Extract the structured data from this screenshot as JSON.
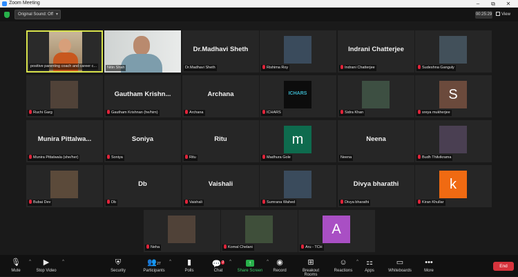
{
  "window": {
    "title": "Zoom Meeting",
    "minimize": "–",
    "maximize": "⧉",
    "close": "✕"
  },
  "topbar": {
    "sound_button": "Original Sound: Off",
    "timer": "00:25:29",
    "view_button": "View"
  },
  "tiles": [
    {
      "label": "positive parenting coach and career c...",
      "muted": false,
      "kind": "video",
      "active": true
    },
    {
      "label": "Nitin Shah",
      "muted": false,
      "kind": "video"
    },
    {
      "big_name": "Dr.Madhavi Sheth",
      "label": "Dr.Madhavi Sheth",
      "muted": false,
      "kind": "name"
    },
    {
      "label": "Rishima Roy",
      "muted": true,
      "kind": "picture"
    },
    {
      "big_name": "Indrani Chatterjee",
      "label": "Indrani Chatterjee",
      "muted": true,
      "kind": "name"
    },
    {
      "label": "Sudeshna Ganguly",
      "muted": true,
      "kind": "picture"
    },
    {
      "label": "Ruchi Garg",
      "muted": true,
      "kind": "picture"
    },
    {
      "big_name": "Gautham Krishn...",
      "label": "Gautham Krishnan (he/him)",
      "muted": true,
      "kind": "name"
    },
    {
      "big_name": "Archana",
      "label": "Archana",
      "muted": true,
      "kind": "name"
    },
    {
      "label": "ICHARS",
      "muted": true,
      "kind": "picture",
      "logo_text": "ICHARS"
    },
    {
      "label": "Sidra Khan",
      "muted": true,
      "kind": "picture"
    },
    {
      "label": "sreya mukherjee",
      "muted": true,
      "kind": "avatar",
      "avatar_letter": "S",
      "avatar_color": "#6b4a3c"
    },
    {
      "big_name": "Munira Pittalwa...",
      "label": "Munira Pittalwala (she/her)",
      "muted": true,
      "kind": "name"
    },
    {
      "big_name": "Soniya",
      "label": "Soniya",
      "muted": true,
      "kind": "name"
    },
    {
      "big_name": "Ritu",
      "label": "Ritu",
      "muted": true,
      "kind": "name"
    },
    {
      "label": "Madhura Gole",
      "muted": true,
      "kind": "avatar",
      "avatar_letter": "m",
      "avatar_color": "#0e6b4e"
    },
    {
      "big_name": "Neena",
      "label": "Neena",
      "muted": false,
      "kind": "name"
    },
    {
      "label": "Budh Thilvikrama",
      "muted": true,
      "kind": "picture"
    },
    {
      "label": "Bubai Dev",
      "muted": true,
      "kind": "picture"
    },
    {
      "big_name": "Db",
      "label": "Db",
      "muted": true,
      "kind": "name"
    },
    {
      "big_name": "Vaishali",
      "label": "Vaishali",
      "muted": true,
      "kind": "name"
    },
    {
      "label": "Sumrana Wahed",
      "muted": true,
      "kind": "picture"
    },
    {
      "big_name": "Divya bharathi",
      "label": "Divya bharathi",
      "muted": true,
      "kind": "name"
    },
    {
      "label": "Kiran Khullar",
      "muted": true,
      "kind": "avatar",
      "avatar_letter": "k",
      "avatar_color": "#f06a12"
    },
    {
      "label": "Neha",
      "muted": true,
      "kind": "picture"
    },
    {
      "label": "Komal Chelani",
      "muted": true,
      "kind": "picture"
    },
    {
      "label": "Aru - TCH",
      "muted": true,
      "kind": "avatar",
      "avatar_letter": "A",
      "avatar_color": "#a94fc4"
    }
  ],
  "toolbar": {
    "mute": "Mute",
    "stop_video": "Stop Video",
    "security": "Security",
    "participants": "Participants",
    "participants_count": "27",
    "polls": "Polls",
    "chat": "Chat",
    "chat_badge": "2",
    "share_screen": "Share Screen",
    "record": "Record",
    "breakout_rooms": "Breakout Rooms",
    "reactions": "Reactions",
    "apps": "Apps",
    "whiteboards": "Whiteboards",
    "more": "More",
    "end": "End"
  },
  "colors": {
    "active_border": "#d8e34c",
    "share_green": "#27b04a",
    "end_red": "#d6333c",
    "mic_muted": "#e0243a"
  }
}
